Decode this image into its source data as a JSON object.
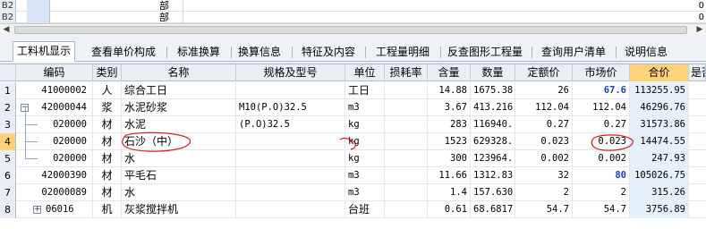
{
  "top_rows": [
    {
      "row": "B2",
      "part": "部",
      "right_value": "0"
    },
    {
      "row": "B2",
      "part": "部",
      "right_value": "0"
    }
  ],
  "tabs": [
    {
      "label": "工料机显示",
      "active": true
    },
    {
      "label": "查看单价构成",
      "active": false
    },
    {
      "label": "标准换算",
      "active": false
    },
    {
      "label": "换算信息",
      "active": false
    },
    {
      "label": "特征及内容",
      "active": false
    },
    {
      "label": "工程量明细",
      "active": false
    },
    {
      "label": "反查图形工程量",
      "active": false
    },
    {
      "label": "查询用户清单",
      "active": false
    },
    {
      "label": "说明信息",
      "active": false
    }
  ],
  "columns": [
    "",
    "编码",
    "类别",
    "名称",
    "规格及型号",
    "单位",
    "损耗率",
    "含量",
    "数量",
    "定额价",
    "市场价",
    "合价",
    "是否"
  ],
  "rows": [
    {
      "no": "1",
      "code": "41000002",
      "type": "人",
      "name": "综合工日",
      "spec": "",
      "unit": "工日",
      "loss": "",
      "content": "14.88",
      "qty": "1675.38",
      "base_price": "26",
      "market_price": "67.6",
      "total": "113255.95",
      "market_blue": true,
      "expander": "",
      "indent": false
    },
    {
      "no": "2",
      "code": "42000044",
      "type": "浆",
      "name": "水泥砂浆",
      "spec": "M10(P.O)32.5",
      "unit": "m3",
      "loss": "",
      "content": "3.67",
      "qty": "413.216",
      "base_price": "112.04",
      "market_price": "112.04",
      "total": "46296.76",
      "market_blue": false,
      "expander": "−",
      "indent": false
    },
    {
      "no": "3",
      "code": "020000",
      "type": "材",
      "name": "水泥",
      "spec": "(P.O)32.5",
      "unit": "kg",
      "loss": "",
      "content": "283",
      "qty": "116940.",
      "base_price": "0.27",
      "market_price": "0.27",
      "total": "31573.86",
      "market_blue": false,
      "expander": "",
      "indent": true
    },
    {
      "no": "4",
      "code": "020000",
      "type": "材",
      "name": "石沙（中）",
      "spec": "",
      "unit": "kg",
      "loss": "",
      "content": "1523",
      "qty": "629328.",
      "base_price": "0.023",
      "market_price": "0.023",
      "total": "14474.55",
      "market_blue": false,
      "expander": "",
      "indent": true
    },
    {
      "no": "5",
      "code": "020000",
      "type": "材",
      "name": "水",
      "spec": "",
      "unit": "kg",
      "loss": "",
      "content": "300",
      "qty": "123964.",
      "base_price": "0.002",
      "market_price": "0.002",
      "total": "247.93",
      "market_blue": false,
      "expander": "",
      "indent": true
    },
    {
      "no": "6",
      "code": "42000390",
      "type": "材",
      "name": "平毛石",
      "spec": "",
      "unit": "m3",
      "loss": "",
      "content": "11.66",
      "qty": "1312.83",
      "base_price": "32",
      "market_price": "80",
      "total": "105026.75",
      "market_blue": true,
      "expander": "",
      "indent": false
    },
    {
      "no": "7",
      "code": "02000089",
      "type": "材",
      "name": "水",
      "spec": "",
      "unit": "m3",
      "loss": "",
      "content": "1.4",
      "qty": "157.630",
      "base_price": "2",
      "market_price": "2",
      "total": "315.26",
      "market_blue": false,
      "expander": "",
      "indent": false
    },
    {
      "no": "8",
      "code": "06016",
      "type": "机",
      "name": "灰浆搅拌机",
      "spec": "",
      "unit": "台班",
      "loss": "",
      "content": "0.61",
      "qty": "68.6817",
      "base_price": "54.7",
      "market_price": "54.7",
      "total": "3756.89",
      "market_blue": false,
      "expander": "+",
      "indent": false
    }
  ],
  "selected_row": "4",
  "colors": {
    "header_highlight": "#ffd27a",
    "total_column": "#e6f0fb",
    "blue_value": "#1a3ec8",
    "annotation": "#d62020"
  }
}
